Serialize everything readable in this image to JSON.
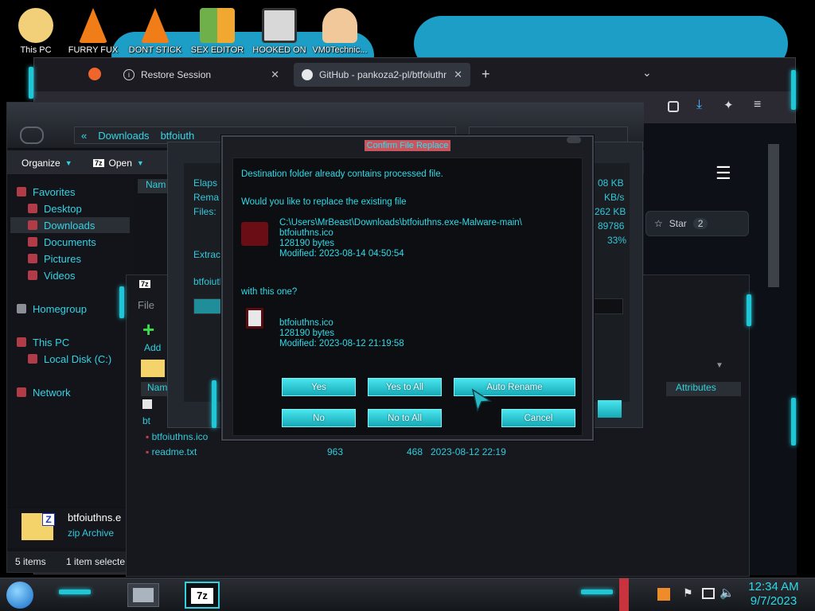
{
  "desktop": {
    "icons": [
      {
        "label": "This PC",
        "icon": "cartoon-face-icon"
      },
      {
        "label": "FURRY FUX",
        "icon": "traffic-cone-icon"
      },
      {
        "label": "DONT STICK",
        "icon": "traffic-cone-icon"
      },
      {
        "label": "SEX EDITOR",
        "icon": "hex-editor-icon"
      },
      {
        "label": "HOOKED ON",
        "icon": "hook-app-icon"
      },
      {
        "label": "VM0Technic...",
        "icon": "doctor-avatar-icon"
      }
    ]
  },
  "browser": {
    "tabs": [
      {
        "label": "Restore Session",
        "icon": "info-icon"
      },
      {
        "label": "GitHub - pankoza2-pl/btfoiuthn",
        "icon": "github-icon"
      }
    ],
    "github": {
      "star_label": "Star",
      "star_count": "2"
    }
  },
  "explorer": {
    "breadcrumb": [
      "«",
      "Downloads",
      "btfoiuth"
    ],
    "toolbar": {
      "organize": "Organize",
      "open": "Open"
    },
    "column_name": "Nam",
    "nav": [
      {
        "label": "Favorites",
        "indent": false
      },
      {
        "label": "Desktop",
        "indent": true
      },
      {
        "label": "Downloads",
        "indent": true,
        "selected": true
      },
      {
        "label": "Documents",
        "indent": true
      },
      {
        "label": "Pictures",
        "indent": true
      },
      {
        "label": "Videos",
        "indent": true
      },
      {
        "label": "Homegroup",
        "indent": false
      },
      {
        "label": "This PC",
        "indent": false
      },
      {
        "label": "Local Disk (C:)",
        "indent": true
      },
      {
        "label": "Network",
        "indent": false
      }
    ],
    "details": {
      "name": "btfoiuthns.e",
      "type": "zip Archive"
    },
    "status": {
      "items": "5 items",
      "selected": "1 item selecte"
    }
  },
  "zip": {
    "title_icon": "7z",
    "menu_file": "File",
    "add_label": "Add",
    "columns": {
      "name": "Nam",
      "attributes": "Attributes"
    },
    "rows": [
      {
        "name": "bt",
        "size": "",
        "packed": "",
        "modified": ""
      },
      {
        "name": "btfoiuthns.ico",
        "size": "",
        "packed": "",
        "modified": ""
      },
      {
        "name": "readme.txt",
        "size": "963",
        "packed": "468",
        "modified": "2023-08-12 22:19"
      }
    ]
  },
  "progress": {
    "labels": [
      "Elaps",
      "Rema",
      "Files:",
      "Extract",
      "btfoiuth"
    ],
    "values": [
      "08 KB",
      "KB/s",
      "262 KB",
      "89786",
      "33%"
    ]
  },
  "dialog": {
    "title": "Confirm File Replace",
    "line1": "Destination folder already contains processed file.",
    "line2": "Would you like to replace the existing file",
    "existing": {
      "path": "C:\\Users\\MrBeast\\Downloads\\btfoiuthns.exe-Malware-main\\",
      "name": "btfoiuthns.ico",
      "size": "128190 bytes",
      "modified": "Modified: 2023-08-14 04:50:54"
    },
    "with_this": "with this one?",
    "incoming": {
      "name": "btfoiuthns.ico",
      "size": "128190 bytes",
      "modified": "Modified: 2023-08-12 21:19:58"
    },
    "buttons": {
      "yes": "Yes",
      "yes_all": "Yes to All",
      "auto_rename": "Auto Rename",
      "no": "No",
      "no_all": "No to All",
      "cancel": "Cancel"
    }
  },
  "taskbar": {
    "time": "12:34 AM",
    "date": "9/7/2023",
    "zip_label": "7z"
  },
  "colors": {
    "accent": "#2fd3e0",
    "dialog_title_bg": "#c9555f",
    "button_top": "#49e6ee"
  }
}
